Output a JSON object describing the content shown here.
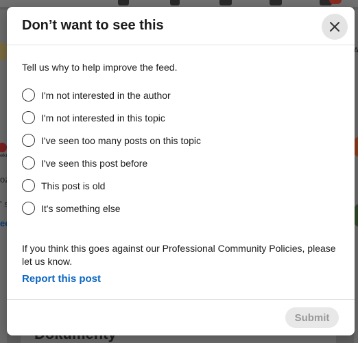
{
  "modal": {
    "title": "Don’t want to see this",
    "close_icon": "close-icon",
    "prompt": "Tell us why to help improve the feed.",
    "options": [
      {
        "label": "I'm not interested in the author",
        "selected": false
      },
      {
        "label": "I'm not interested in this topic",
        "selected": false
      },
      {
        "label": "I've seen too many posts on this topic",
        "selected": false
      },
      {
        "label": "I've seen this post before",
        "selected": false
      },
      {
        "label": "This post is old",
        "selected": false
      },
      {
        "label": "It's something else",
        "selected": false
      }
    ],
    "policy_text": "If you think this goes against our Professional Community Policies, please let us know.",
    "report_link": "Report this post",
    "submit_label": "Submit",
    "submit_enabled": false
  },
  "background": {
    "bottom_text": "Dokumenty",
    "left_snippets": [
      "eku",
      "oz",
      "' s",
      "ee"
    ],
    "right_snippet": "A"
  },
  "colors": {
    "link": "#0a66c2",
    "submit_disabled_bg": "#e8e8e8",
    "submit_disabled_text": "#9a9a9a",
    "overlay": "#5f5f5f"
  }
}
